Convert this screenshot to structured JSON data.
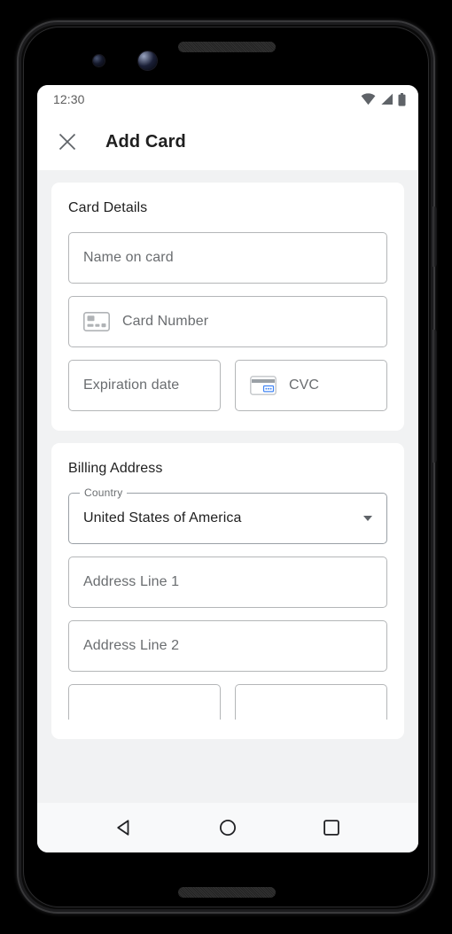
{
  "device": {
    "camera_small": "camera-lens-small",
    "camera_large": "camera-lens-large",
    "speaker": "earpiece-speaker"
  },
  "status_bar": {
    "time": "12:30",
    "icons": [
      "wifi-icon",
      "cell-signal-icon",
      "battery-icon"
    ]
  },
  "app_bar": {
    "close_icon": "close-icon",
    "title": "Add Card"
  },
  "sections": [
    {
      "title": "Card Details",
      "fields": [
        {
          "name": "name-on-card",
          "placeholder": "Name on card",
          "icon": null
        },
        {
          "name": "card-number",
          "placeholder": "Card Number",
          "icon": "credit-card-icon"
        }
      ],
      "row_fields": [
        {
          "name": "expiration-date",
          "placeholder": "Expiration date",
          "icon": null
        },
        {
          "name": "cvc",
          "placeholder": "CVC",
          "icon": "cvc-card-icon"
        }
      ]
    },
    {
      "title": "Billing Address",
      "country_select": {
        "label": "Country",
        "value": "United States of America",
        "arrow_icon": "chevron-down-icon"
      },
      "fields": [
        {
          "name": "address-line-1",
          "placeholder": "Address Line 1"
        },
        {
          "name": "address-line-2",
          "placeholder": "Address Line 2"
        }
      ]
    }
  ],
  "nav_bar": {
    "back": "back-triangle-icon",
    "home": "home-circle-icon",
    "recents": "recents-square-icon"
  },
  "colors": {
    "page_background": "#f1f2f3",
    "card_background": "#ffffff",
    "text_primary": "#1f1f1f",
    "text_secondary": "#6a6d70",
    "border": "#b4b6b8",
    "accent_blue": "#4285f4"
  }
}
